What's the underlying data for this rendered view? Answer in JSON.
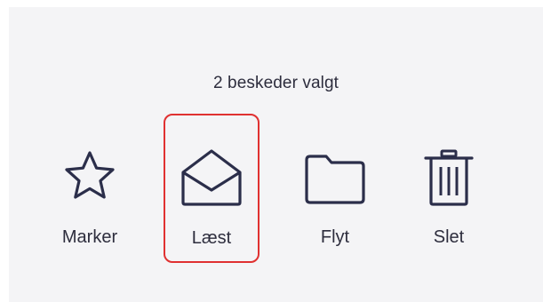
{
  "selection": {
    "count_text": "2 beskeder valgt"
  },
  "actions": [
    {
      "label": "Marker",
      "icon": "star-icon"
    },
    {
      "label": "Læst",
      "icon": "envelope-open-icon",
      "highlighted": true
    },
    {
      "label": "Flyt",
      "icon": "folder-icon"
    },
    {
      "label": "Slet",
      "icon": "trash-icon"
    }
  ],
  "colors": {
    "icon_stroke": "#2b2e4a",
    "text": "#2d2d3d",
    "highlight_border": "#e03131",
    "panel_background": "#f4f4f6"
  }
}
